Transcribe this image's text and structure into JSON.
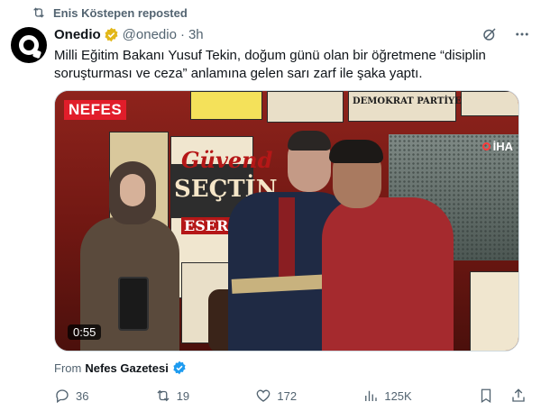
{
  "repost": {
    "text": "Enis Köstepen reposted"
  },
  "author": {
    "name": "Onedio",
    "handle": "@onedio",
    "separator": "·",
    "time": "3h"
  },
  "tweet": {
    "text": "Milli Eğitim Bakanı Yusuf Tekin, doğum günü olan bir öğretmene “disiplin soruşturması ve ceza” anlamına gelen sarı zarf ile şaka yaptı."
  },
  "media": {
    "logo": "NEFES",
    "watermark": "İHA",
    "duration": "0:55",
    "poster_texts": {
      "a": "Güvend",
      "b": "SEÇTİN",
      "c": "ESERİNİ",
      "d": "DEMOKRAT PARTİYE"
    }
  },
  "attribution": {
    "prefix": "From",
    "source": "Nefes Gazetesi"
  },
  "actions": {
    "replies": "36",
    "reposts": "19",
    "likes": "172",
    "views": "125K"
  },
  "colors": {
    "accent": "#1d9bf0",
    "gold_badge": "#e2b719",
    "muted": "#536471",
    "like": "#536471"
  },
  "icons": [
    "repost-icon",
    "verified-gold-icon",
    "grok-icon",
    "more-icon",
    "verified-blue-icon",
    "reply-icon",
    "like-icon",
    "views-icon",
    "bookmark-icon",
    "share-icon"
  ]
}
